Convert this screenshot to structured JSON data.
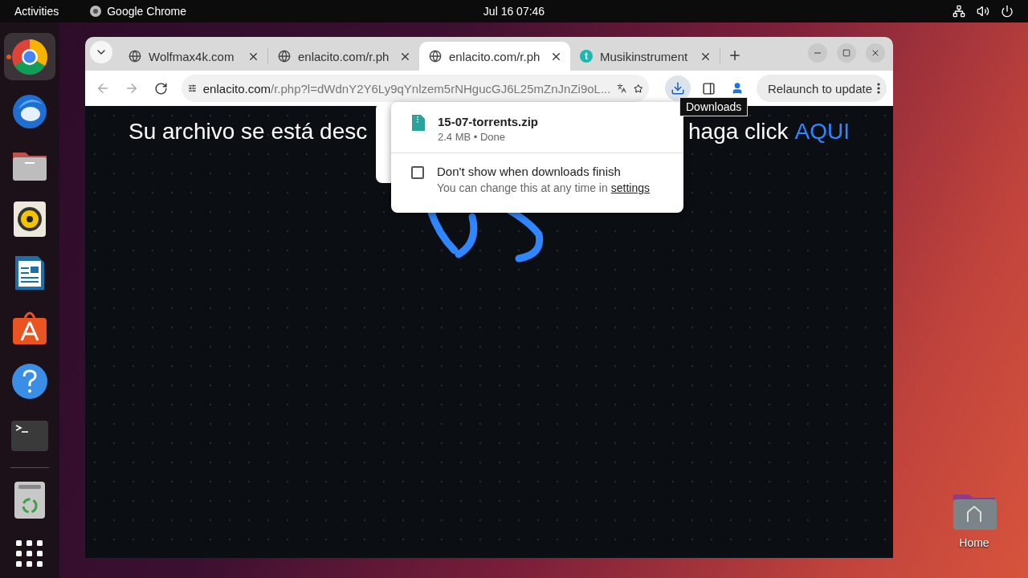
{
  "top_bar": {
    "activities": "Activities",
    "app_name": "Google Chrome",
    "clock": "Jul 16  07:46"
  },
  "dock": [
    {
      "kind": "chrome",
      "running": true
    },
    {
      "kind": "mail",
      "running": false
    },
    {
      "kind": "files",
      "running": false
    },
    {
      "kind": "music",
      "running": false
    },
    {
      "kind": "writer",
      "running": false
    },
    {
      "kind": "store",
      "running": false
    },
    {
      "kind": "help",
      "running": false
    },
    {
      "kind": "terminal",
      "running": false
    },
    {
      "kind": "separator"
    },
    {
      "kind": "trash",
      "running": false
    },
    {
      "kind": "apps",
      "running": false
    }
  ],
  "desktop_icons": [
    {
      "label": "Home"
    }
  ],
  "browser": {
    "tabs": [
      {
        "title": "Wolfmax4k.com",
        "selected": false
      },
      {
        "title": "enlacito.com/r.ph",
        "selected": false
      },
      {
        "title": "enlacito.com/r.ph",
        "selected": true
      },
      {
        "title": "Musikinstrument",
        "letter": "t",
        "selected": false
      }
    ],
    "url": {
      "host": "enlacito.com",
      "path": "/r.php?l=dWdnY2Y6Ly9qYnlzem5rNHgucGJ6L25mZnJnZi9oL..."
    },
    "relaunch": "Relaunch to update",
    "tooltip": "Downloads",
    "downloads": {
      "file_name": "15-07-torrents.zip",
      "file_info": "2.4 MB • Done",
      "option": {
        "label": "Don't show when downloads finish",
        "checked": false
      },
      "hint": "You can change this at any time in",
      "hint_link": "settings"
    },
    "page": {
      "heading_left": "Su archivo se está desc",
      "heading_right": "haga click",
      "link": "AQUI"
    }
  }
}
